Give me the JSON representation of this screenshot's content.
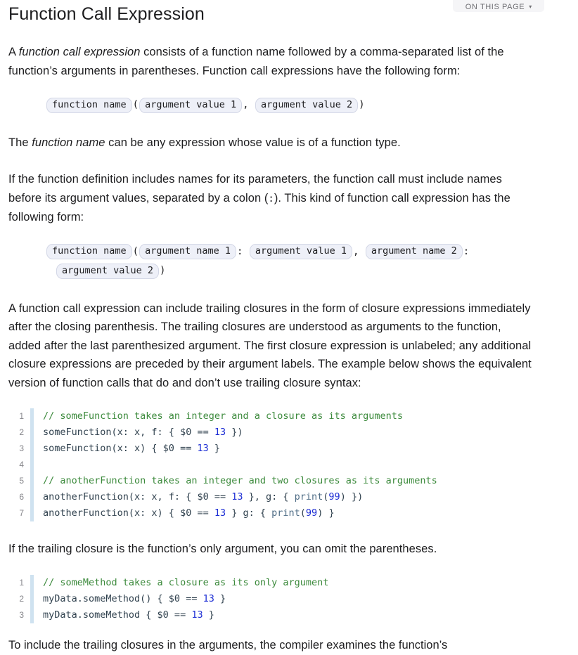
{
  "on_this_page": {
    "label": "ON THIS PAGE",
    "caret": "▾"
  },
  "page": {
    "title": "Function Call Expression"
  },
  "paragraphs": {
    "p1_a": "A ",
    "p1_em": "function call expression",
    "p1_b": " consists of a function name followed by a comma-separated list of the function’s arguments in parentheses. Function call expressions have the following form:",
    "p2_a": "The ",
    "p2_em": "function name",
    "p2_b": " can be any expression whose value is of a function type.",
    "p3_a": "If the function definition includes names for its parameters, the function call must include names before its argument values, separated by a colon (",
    "p3_code": ":",
    "p3_b": "). This kind of function call expression has the following form:",
    "p4": "A function call expression can include trailing closures in the form of closure expressions immediately after the closing parenthesis. The trailing closures are understood as arguments to the function, added after the last parenthesized argument. The first closure expression is unlabeled; any additional closure expressions are preceded by their argument labels. The example below shows the equivalent version of function calls that do and don’t use trailing closure syntax:",
    "p5": "If the trailing closure is the function’s only argument, you can omit the parentheses.",
    "p6_cut": "To include the trailing closures in the arguments, the compiler examines the function’s"
  },
  "syntax_block_1": {
    "ph_function_name": "function name",
    "open_paren": "(",
    "ph_arg_value_1": "argument value 1",
    "comma": ",",
    "ph_arg_value_2": "argument value 2",
    "close_paren": ")"
  },
  "syntax_block_2": {
    "ph_function_name": "function name",
    "open_paren": "(",
    "ph_arg_name_1": "argument name 1",
    "colon_1": ":",
    "ph_arg_value_1": "argument value 1",
    "comma": ",",
    "ph_arg_name_2": "argument name 2",
    "colon_2": ":",
    "ph_arg_value_2": "argument value 2",
    "close_paren": ")"
  },
  "code_block_1": {
    "lines": [
      {
        "number": "1",
        "tokens": [
          {
            "t": "// someFunction takes an integer and a closure as its arguments",
            "c": "comment"
          }
        ]
      },
      {
        "number": "2",
        "tokens": [
          {
            "t": "someFunction(x: x, f: { $0 == ",
            "c": "plain"
          },
          {
            "t": "13",
            "c": "num"
          },
          {
            "t": " })",
            "c": "plain"
          }
        ]
      },
      {
        "number": "3",
        "tokens": [
          {
            "t": "someFunction(x: x) { $0 == ",
            "c": "plain"
          },
          {
            "t": "13",
            "c": "num"
          },
          {
            "t": " }",
            "c": "plain"
          }
        ]
      },
      {
        "number": "4",
        "tokens": [
          {
            "t": "",
            "c": "plain"
          }
        ]
      },
      {
        "number": "5",
        "tokens": [
          {
            "t": "// anotherFunction takes an integer and two closures as its arguments",
            "c": "comment"
          }
        ]
      },
      {
        "number": "6",
        "tokens": [
          {
            "t": "anotherFunction(x: x, f: { $0 == ",
            "c": "plain"
          },
          {
            "t": "13",
            "c": "num"
          },
          {
            "t": " }, g: { ",
            "c": "plain"
          },
          {
            "t": "print",
            "c": "func"
          },
          {
            "t": "(",
            "c": "plain"
          },
          {
            "t": "99",
            "c": "num"
          },
          {
            "t": ") })",
            "c": "plain"
          }
        ]
      },
      {
        "number": "7",
        "tokens": [
          {
            "t": "anotherFunction(x: x) { $0 == ",
            "c": "plain"
          },
          {
            "t": "13",
            "c": "num"
          },
          {
            "t": " } g: { ",
            "c": "plain"
          },
          {
            "t": "print",
            "c": "func"
          },
          {
            "t": "(",
            "c": "plain"
          },
          {
            "t": "99",
            "c": "num"
          },
          {
            "t": ") }",
            "c": "plain"
          }
        ]
      }
    ]
  },
  "code_block_2": {
    "lines": [
      {
        "number": "1",
        "tokens": [
          {
            "t": "// someMethod takes a closure as its only argument",
            "c": "comment"
          }
        ]
      },
      {
        "number": "2",
        "tokens": [
          {
            "t": "myData.someMethod() { $0 == ",
            "c": "plain"
          },
          {
            "t": "13",
            "c": "num"
          },
          {
            "t": " }",
            "c": "plain"
          }
        ]
      },
      {
        "number": "3",
        "tokens": [
          {
            "t": "myData.someMethod { $0 == ",
            "c": "plain"
          },
          {
            "t": "13",
            "c": "num"
          },
          {
            "t": " }",
            "c": "plain"
          }
        ]
      }
    ]
  },
  "colors": {
    "text": "#1d1d1f",
    "code_text": "#31424f",
    "comment": "#3c8a3c",
    "number": "#1d2ed4",
    "function": "#4f6d86",
    "gutter_rule": "#cfe2f0",
    "placeholder_bg": "#eef0f8",
    "placeholder_border": "#d3d7e6"
  }
}
